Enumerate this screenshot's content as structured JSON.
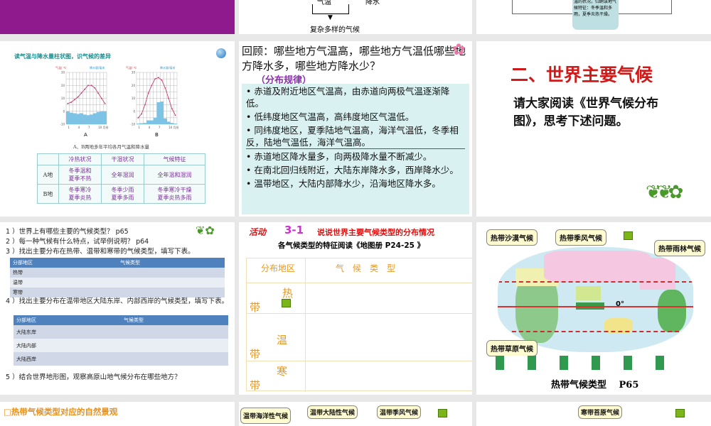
{
  "slide_top_middle": {
    "labels": [
      "气温",
      "降水"
    ],
    "result": "复杂多样的气候"
  },
  "slide_top_right": {
    "note": "温的状况，归纳该地气候特征：冬季温和多雨，夏季炎热干燥。"
  },
  "slide_climograph": {
    "title": "读气温与降水量柱状图，识气候的差异",
    "axis_left": "气温/ ℃",
    "axis_right": "降水量/毫米",
    "x_ticks": [
      "1",
      "4",
      "7",
      "10 月份"
    ],
    "chart_labels": [
      "A",
      "B"
    ],
    "caption": "A、B两地多年平均各月气温和降水量",
    "chart_data": [
      {
        "type": "bar+line",
        "name": "A",
        "temp_ylim": [
          -10,
          30
        ],
        "precip_ylim": [
          0,
          400
        ],
        "temperature": [
          6,
          7,
          9,
          11,
          14,
          17,
          20,
          20,
          18,
          14,
          10,
          6
        ],
        "precipitation": [
          100,
          90,
          85,
          80,
          85,
          75,
          70,
          75,
          85,
          95,
          100,
          100
        ]
      },
      {
        "type": "bar+line",
        "name": "B",
        "temp_ylim": [
          -10,
          30
        ],
        "precip_ylim": [
          0,
          400
        ],
        "temperature": [
          -5,
          -2,
          5,
          14,
          20,
          25,
          26,
          24,
          18,
          10,
          2,
          -3
        ],
        "precipitation": [
          5,
          8,
          10,
          30,
          30,
          50,
          170,
          175,
          45,
          20,
          10,
          5
        ]
      }
    ],
    "table": {
      "headers": [
        "",
        "冷热状况",
        "干湿状况",
        "气候特征"
      ],
      "rows": [
        [
          "A地",
          "冬季温和\n夏季不热",
          "全年湿润",
          "全年温和湿润"
        ],
        [
          "B地",
          "冬季寒冷\n夏季炎热",
          "冬季少雨\n夏季多雨",
          "冬季寒冷干燥\n夏季炎热多雨"
        ]
      ]
    }
  },
  "slide_review": {
    "title": "回顾：哪些地方气温高，哪些地方气温低哪些地方降水多，哪些地方降水少？",
    "subtitle": "（分布规律）",
    "bullets": [
      "赤道及附近地区气温高，由赤道向两极气温逐渐降低。",
      "低纬度地区气温高，高纬度地区气温低。",
      "同纬度地区，夏季陆地气温高，海洋气温低，冬季相反，陆地气温低，海洋气温高。",
      "赤道地区降水量多，向两极降水量不断减少。",
      "在南北回归线附近，大陆东岸降水多，西岸降水少。",
      "温带地区，大陆内部降水少，沿海地区降水多。"
    ]
  },
  "slide_world": {
    "title": "二、世界主要气候",
    "body": "请大家阅读《世界气候分布图》，思考下述问题。"
  },
  "slide_questions": {
    "q1": "1 ）世界上有哪些主要的气候类型？ p65",
    "q2": "2 ）每一种气候有什么特点，试举例说明？ p64",
    "q3": "3 ）找出主要分布在热带、温带和寒带的气候类型，填写下表。",
    "table1": {
      "headers": [
        "分部地区",
        "气候类型"
      ],
      "rows": [
        "热带",
        "温带",
        "寒带"
      ]
    },
    "q4": "4 ）找出主要分布在温带地区大陆东岸、内部西岸的气候类型，填写下表。",
    "table2": {
      "headers": [
        "分部地区",
        "气候类型"
      ],
      "rows": [
        "大陆东岸",
        "大陆内部",
        "大陆西岸"
      ]
    },
    "q5": "5 ）结合世界地形图，观察高原山地气候分布在哪些地方？"
  },
  "slide_activity": {
    "tag": "活动",
    "num": "3-1",
    "title": "说说世界主要气候类型的分布情况",
    "subtitle": "各气候类型的特征阅读《地图册 P24-25 》",
    "col1": "分布地区",
    "col2": "气　候　类　型",
    "rows": [
      [
        "热",
        "带"
      ],
      [
        "温",
        "带"
      ],
      [
        "寒",
        "带"
      ]
    ]
  },
  "slide_map": {
    "bubbles": [
      "热带沙漠气候",
      "热带季风气候",
      "热带雨林气候",
      "热带草原气候"
    ],
    "equator": "0°",
    "caption": "热带气候类型　 P65"
  },
  "bottom": {
    "left_title": "□热带气候类型对应的自然景观",
    "mid_bubbles": [
      "温带海洋性气候",
      "温带大陆性气候",
      "温带季风气候"
    ],
    "right_bubble": "寒带苔原气候"
  }
}
